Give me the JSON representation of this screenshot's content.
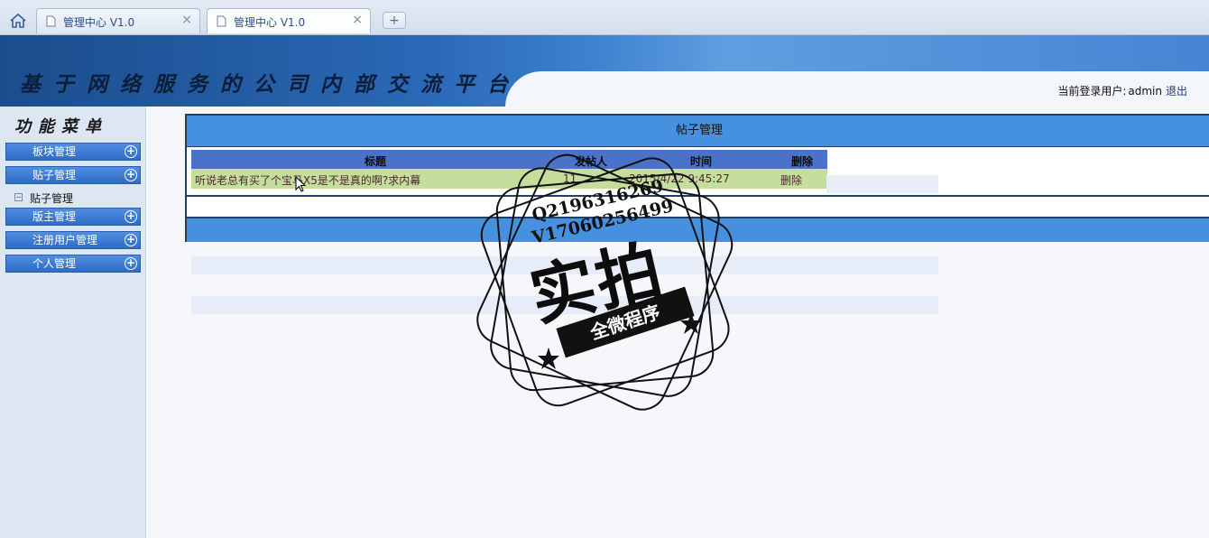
{
  "browser": {
    "tabs": [
      {
        "title": "管理中心 V1.0"
      },
      {
        "title": "管理中心 V1.0"
      }
    ],
    "new_tab": "+",
    "close_glyph": "×"
  },
  "header": {
    "site_title": "基于网络服务的公司内部交流平台",
    "login_label": "当前登录用户:",
    "login_user": "admin",
    "logout": "退出"
  },
  "sidebar": {
    "heading": "功能菜单",
    "items": [
      {
        "label": "板块管理"
      },
      {
        "label": "贴子管理"
      },
      {
        "label": "版主管理"
      },
      {
        "label": "注册用户管理"
      },
      {
        "label": "个人管理"
      }
    ],
    "sub_items": [
      {
        "label": "贴子管理"
      }
    ]
  },
  "main": {
    "panel_title": "帖子管理",
    "table": {
      "headers": [
        "标题",
        "发帖人",
        "时间",
        "删除"
      ],
      "rows": [
        {
          "title": "听说老总有买了个宝马X5是不是真的啊?求内幕",
          "poster": "11",
          "time": "2015/4/22 9:45:27",
          "delete": "删除"
        }
      ]
    }
  },
  "watermark": {
    "line1": "Q2196316269",
    "line2": "V17060256499",
    "big": "实拍",
    "ribbon": "全微程序"
  },
  "colors": {
    "banner": "#2a68b6",
    "panel_header": "#4591e0",
    "table_header": "#4a72c9",
    "table_row": "#c5dd9d",
    "sidebar_bg": "#dde7f4"
  }
}
